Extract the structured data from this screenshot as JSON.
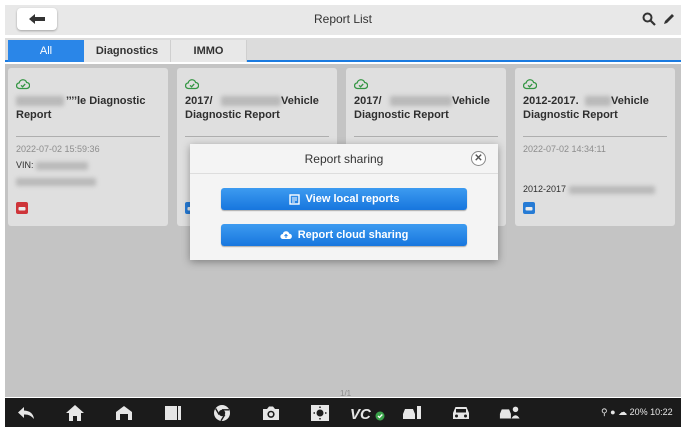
{
  "header": {
    "title": "Report List"
  },
  "tabs": [
    {
      "label": "All",
      "active": true
    },
    {
      "label": "Diagnostics",
      "active": false
    },
    {
      "label": "IMMO",
      "active": false
    }
  ],
  "cards": [
    {
      "title_line1": "’’’’le Diagnostic",
      "title_line2": "Report",
      "date": "2022-07-02 15:59:36",
      "vin": "VIN:",
      "icon_color": "#e0393e"
    },
    {
      "title_line1": "2017/",
      "title_line1_end": "Vehicle",
      "title_line2": "Diagnostic Report",
      "date": "",
      "icon_color": "#2a86e8"
    },
    {
      "title_line1": "2017/",
      "title_line1_end": "Vehicle",
      "title_line2": "Diagnostic Report",
      "date": ""
    },
    {
      "title_line1": "2012-2017.",
      "title_line1_end": "Vehicle",
      "title_line2": "Diagnostic Report",
      "date": "2022-07-02 14:34:11",
      "extra": "2012-2017",
      "icon_color": "#2a86e8"
    }
  ],
  "dialog": {
    "title": "Report sharing",
    "close_icon": "close-icon",
    "local_label": "View local reports",
    "cloud_label": "Report cloud sharing"
  },
  "page_indicator": "1/1",
  "status_bar": {
    "text": "20% 10:22"
  },
  "colors": {
    "accent": "#2a86e8",
    "cloud_icon": "#3aa34a",
    "nav_bg": "#1b1b1b"
  }
}
